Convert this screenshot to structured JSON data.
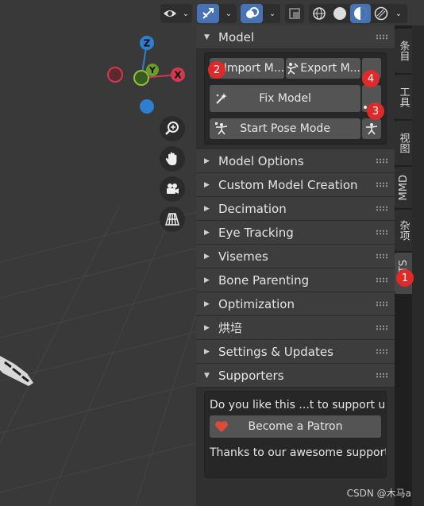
{
  "colors": {
    "accent": "#4772b3",
    "marker": "#e02a2a",
    "axis_x": "#d23850",
    "axis_y": "#6b9c2c",
    "axis_z": "#2f7fd1"
  },
  "gizmo": {
    "x_label": "X",
    "y_label": "Y",
    "z_label": "Z"
  },
  "panel": {
    "model_section": {
      "title": "Model",
      "import_label": "Import M...",
      "export_label": "Export M...",
      "fix_label": "Fix Model",
      "pose_label": "Start Pose Mode"
    },
    "sections": [
      "Model Options",
      "Custom Model Creation",
      "Decimation",
      "Eye Tracking",
      "Visemes",
      "Bone Parenting",
      "Optimization",
      "烘培",
      "Settings & Updates"
    ],
    "supporters": {
      "title": "Supporters",
      "question": "Do you like this ...t to support us?",
      "patron_label": "Become a Patron",
      "thanks": "Thanks to our awesome support..."
    }
  },
  "tabs": [
    "条目",
    "工具",
    "视图",
    "MMD",
    "杂项",
    "CATS"
  ],
  "markers": [
    "1",
    "2",
    "3",
    "4"
  ],
  "watermark": "CSDN @木马a"
}
